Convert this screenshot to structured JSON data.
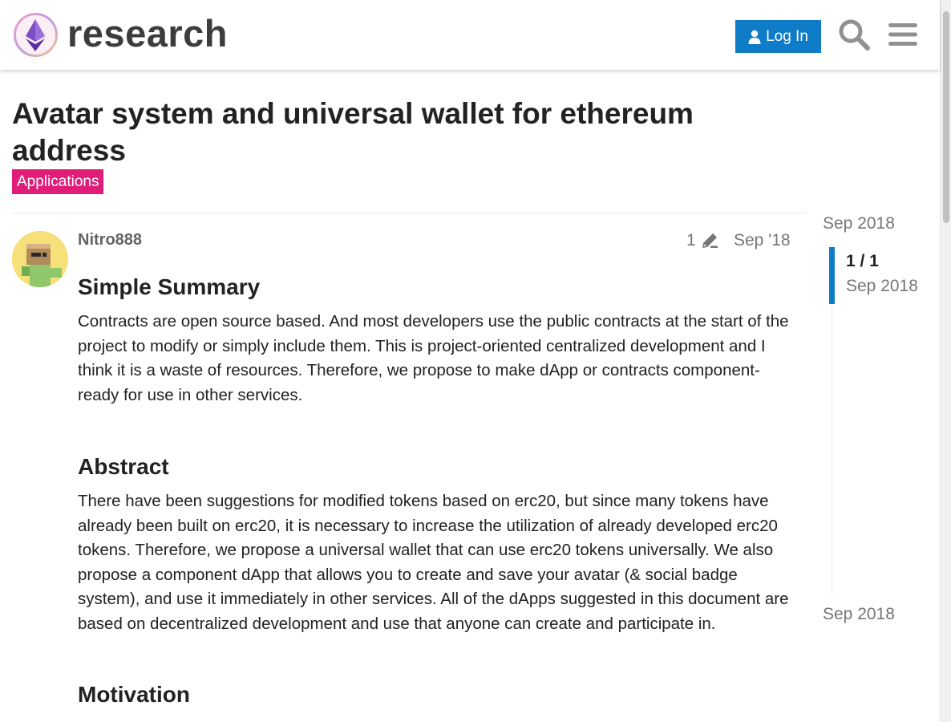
{
  "header": {
    "logo_text": "research",
    "login_label": "Log In",
    "accent_color": "#0f7cc8"
  },
  "topic": {
    "title": "Avatar system and universal wallet for ethereum address",
    "category": "Applications",
    "category_color": "#e01e7a"
  },
  "post": {
    "username": "Nitro888",
    "edit_count": "1",
    "date": "Sep '18",
    "sections": [
      {
        "heading": "Simple Summary",
        "text": "Contracts are open source based. And most developers use the public contracts at the start of the project to modify or simply include them. This is project-oriented centralized development and I think it is a waste of resources. Therefore, we propose to make dApp or contracts component-ready for use in other services."
      },
      {
        "heading": "Abstract",
        "text": "There have been suggestions for modified tokens based on erc20, but since many tokens have already been built on erc20, it is necessary to increase the utilization of already developed erc20 tokens. Therefore, we propose a universal wallet that can use erc20 tokens universally. We also propose a component dApp that allows you to create and save your avatar (& social badge system), and use it immediately in other services. All of the dApps suggested in this document are based on decentralized development and use that anyone can create and participate in."
      },
      {
        "heading": "Motivation"
      }
    ]
  },
  "timeline": {
    "start_date": "Sep 2018",
    "position": "1 / 1",
    "current_date": "Sep 2018",
    "end_date": "Sep 2018"
  }
}
